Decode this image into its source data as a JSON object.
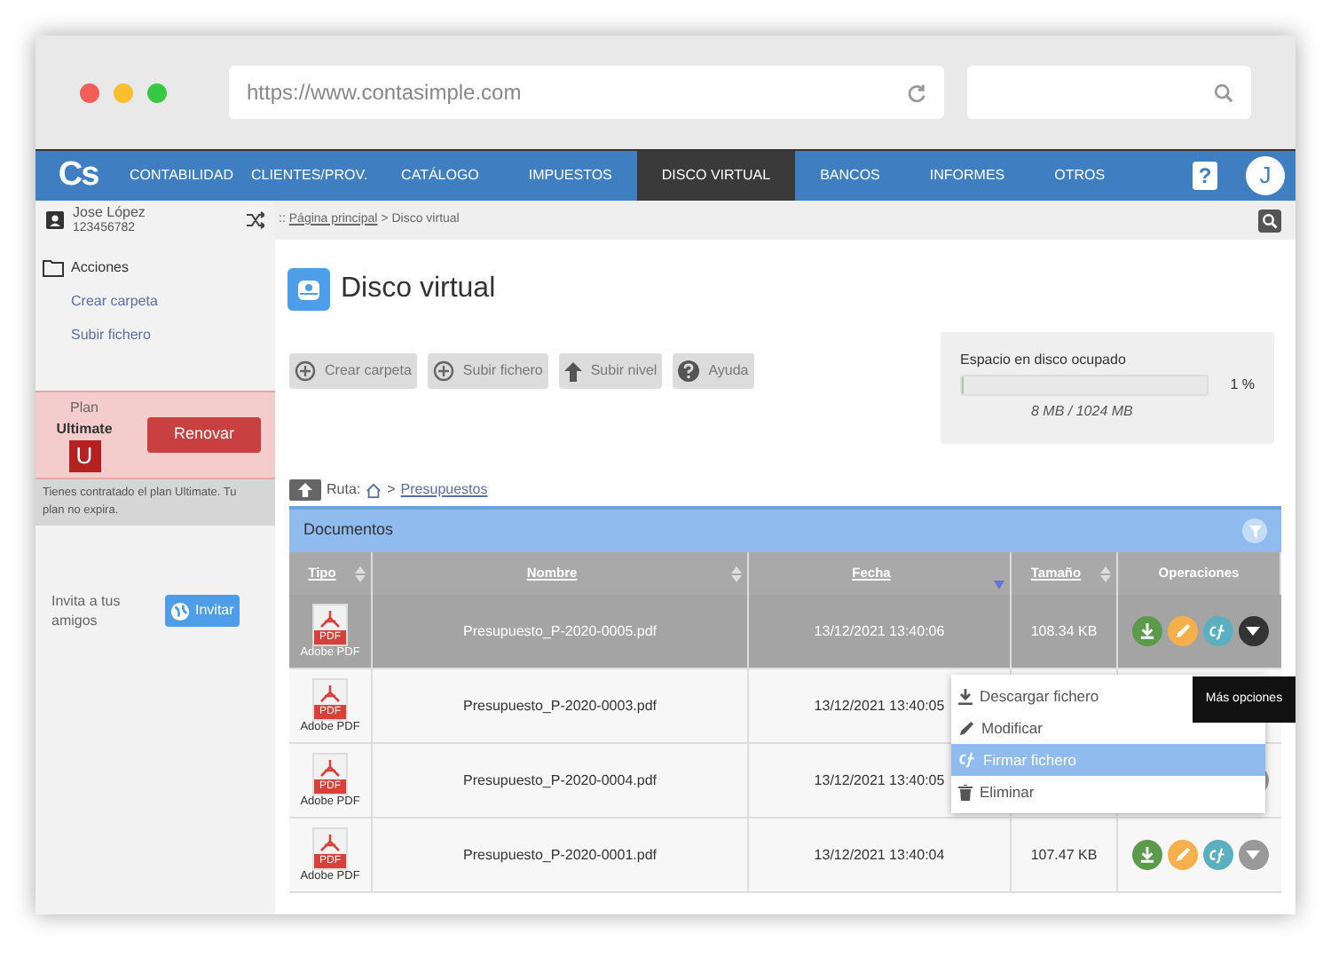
{
  "browser": {
    "url": "https://www.contasimple.com"
  },
  "nav": {
    "logo": "Cs",
    "items": [
      {
        "label": "CONTABILIDAD",
        "selected": false
      },
      {
        "label": "CLIENTES/PROV.",
        "selected": false
      },
      {
        "label": "CATÁLOGO",
        "selected": false
      },
      {
        "label": "IMPUESTOS",
        "selected": false
      },
      {
        "label": "DISCO VIRTUAL",
        "selected": true
      },
      {
        "label": "BANCOS",
        "selected": false
      },
      {
        "label": "INFORMES",
        "selected": false
      },
      {
        "label": "OTROS",
        "selected": false
      }
    ],
    "help": "?",
    "avatar": "J"
  },
  "sidebar": {
    "user_name": "Jose López",
    "user_id": "123456782",
    "actions_title": "Acciones",
    "actions": [
      "Crear carpeta",
      "Subir fichero"
    ],
    "plan_label": "Plan",
    "plan_name": "Ultimate",
    "plan_badge": "U",
    "renew_button": "Renovar",
    "plan_note": "Tienes contratado el plan Ultimate. Tu plan no expira.",
    "invite_text": "Invita a tus amigos",
    "invite_button": "Invitar"
  },
  "breadcrumb": {
    "prefix": "::",
    "link": "Página principal",
    "current": "> Disco virtual"
  },
  "page_title": "Disco virtual",
  "toolbar": [
    {
      "kind": "plus",
      "label": "Crear carpeta"
    },
    {
      "kind": "plus",
      "label": "Subir fichero"
    },
    {
      "kind": "up",
      "label": "Subir nivel"
    },
    {
      "kind": "help",
      "label": "Ayuda"
    }
  ],
  "disk": {
    "title": "Espacio en disco ocupado",
    "level": 0.01,
    "percent": "1 %",
    "usage": "8 MB / 1024 MB"
  },
  "path": {
    "label": "Ruta:",
    "separator": ">",
    "folder": "Presupuestos"
  },
  "panel_title": "Documentos",
  "table": {
    "columns": [
      {
        "label": "Tipo",
        "sortable": true,
        "sorted_desc": false
      },
      {
        "label": "Nombre",
        "sortable": true,
        "sorted_desc": false
      },
      {
        "label": "Fecha",
        "sortable": false,
        "sorted_desc": true
      },
      {
        "label": "Tamaño",
        "sortable": true,
        "sorted_desc": false
      },
      {
        "label": "Operaciones",
        "sortable": false,
        "sorted_desc": false
      }
    ],
    "rows": [
      {
        "type_badge": "PDF",
        "type": "Adobe PDF",
        "name": "Presupuesto_P-2020-0005.pdf",
        "date": "13/12/2021 13:40:06",
        "size": "108.34 KB",
        "selected": true
      },
      {
        "type_badge": "PDF",
        "type": "Adobe PDF",
        "name": "Presupuesto_P-2020-0003.pdf",
        "date": "13/12/2021 13:40:05",
        "selected": false
      },
      {
        "type_badge": "PDF",
        "type": "Adobe PDF",
        "name": "Presupuesto_P-2020-0004.pdf",
        "date": "13/12/2021 13:40:05",
        "selected": false
      },
      {
        "type_badge": "PDF",
        "type": "Adobe PDF",
        "name": "Presupuesto_P-2020-0001.pdf",
        "date": "13/12/2021 13:40:04",
        "size": "107.47 KB",
        "selected": false
      }
    ]
  },
  "menu": [
    {
      "kind": "download",
      "label": "Descargar fichero",
      "selected": false
    },
    {
      "kind": "edit",
      "label": "Modificar",
      "selected": false
    },
    {
      "kind": "sign",
      "label": "Firmar fichero",
      "selected": true
    },
    {
      "kind": "delete",
      "label": "Eliminar",
      "selected": false
    }
  ],
  "tooltip": "Más opciones"
}
